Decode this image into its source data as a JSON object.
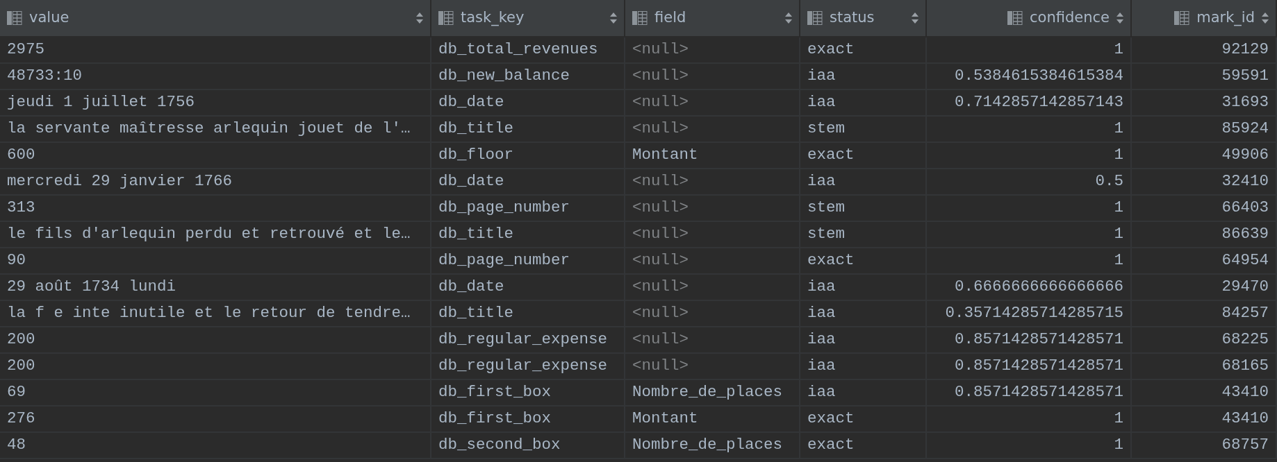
{
  "table": {
    "columns": [
      {
        "label": "value",
        "numeric": false
      },
      {
        "label": "task_key",
        "numeric": false
      },
      {
        "label": "field",
        "numeric": false
      },
      {
        "label": "status",
        "numeric": false
      },
      {
        "label": "confidence",
        "numeric": true
      },
      {
        "label": "mark_id",
        "numeric": true
      }
    ],
    "rows": [
      {
        "cells": [
          {
            "text": "2975",
            "null": false
          },
          {
            "text": "db_total_revenues",
            "null": false
          },
          {
            "text": "<null>",
            "null": true
          },
          {
            "text": "exact",
            "null": false
          },
          {
            "text": "1",
            "null": false
          },
          {
            "text": "92129",
            "null": false
          }
        ]
      },
      {
        "cells": [
          {
            "text": "48733:10",
            "null": false
          },
          {
            "text": "db_new_balance",
            "null": false
          },
          {
            "text": "<null>",
            "null": true
          },
          {
            "text": "iaa",
            "null": false
          },
          {
            "text": "0.5384615384615384",
            "null": false
          },
          {
            "text": "59591",
            "null": false
          }
        ]
      },
      {
        "cells": [
          {
            "text": "jeudi 1 juillet 1756",
            "null": false
          },
          {
            "text": "db_date",
            "null": false
          },
          {
            "text": "<null>",
            "null": true
          },
          {
            "text": "iaa",
            "null": false
          },
          {
            "text": "0.7142857142857143",
            "null": false
          },
          {
            "text": "31693",
            "null": false
          }
        ]
      },
      {
        "cells": [
          {
            "text": "la servante maîtresse arlequin jouet de l'…",
            "null": false
          },
          {
            "text": "db_title",
            "null": false
          },
          {
            "text": "<null>",
            "null": true
          },
          {
            "text": "stem",
            "null": false
          },
          {
            "text": "1",
            "null": false
          },
          {
            "text": "85924",
            "null": false
          }
        ]
      },
      {
        "cells": [
          {
            "text": "600",
            "null": false
          },
          {
            "text": "db_floor",
            "null": false
          },
          {
            "text": "Montant",
            "null": false
          },
          {
            "text": "exact",
            "null": false
          },
          {
            "text": "1",
            "null": false
          },
          {
            "text": "49906",
            "null": false
          }
        ]
      },
      {
        "cells": [
          {
            "text": "mercredi 29 janvier 1766",
            "null": false
          },
          {
            "text": "db_date",
            "null": false
          },
          {
            "text": "<null>",
            "null": true
          },
          {
            "text": "iaa",
            "null": false
          },
          {
            "text": "0.5",
            "null": false
          },
          {
            "text": "32410",
            "null": false
          }
        ]
      },
      {
        "cells": [
          {
            "text": "313",
            "null": false
          },
          {
            "text": "db_page_number",
            "null": false
          },
          {
            "text": "<null>",
            "null": true
          },
          {
            "text": "stem",
            "null": false
          },
          {
            "text": "1",
            "null": false
          },
          {
            "text": "66403",
            "null": false
          }
        ]
      },
      {
        "cells": [
          {
            "text": "le fils d'arlequin perdu et retrouvé et le…",
            "null": false
          },
          {
            "text": "db_title",
            "null": false
          },
          {
            "text": "<null>",
            "null": true
          },
          {
            "text": "stem",
            "null": false
          },
          {
            "text": "1",
            "null": false
          },
          {
            "text": "86639",
            "null": false
          }
        ]
      },
      {
        "cells": [
          {
            "text": "90",
            "null": false
          },
          {
            "text": "db_page_number",
            "null": false
          },
          {
            "text": "<null>",
            "null": true
          },
          {
            "text": "exact",
            "null": false
          },
          {
            "text": "1",
            "null": false
          },
          {
            "text": "64954",
            "null": false
          }
        ]
      },
      {
        "cells": [
          {
            "text": "29 août 1734 lundi",
            "null": false
          },
          {
            "text": "db_date",
            "null": false
          },
          {
            "text": "<null>",
            "null": true
          },
          {
            "text": "iaa",
            "null": false
          },
          {
            "text": "0.6666666666666666",
            "null": false
          },
          {
            "text": "29470",
            "null": false
          }
        ]
      },
      {
        "cells": [
          {
            "text": "la f e inte inutile et le retour de tendre…",
            "null": false
          },
          {
            "text": "db_title",
            "null": false
          },
          {
            "text": "<null>",
            "null": true
          },
          {
            "text": "iaa",
            "null": false
          },
          {
            "text": "0.35714285714285715",
            "null": false
          },
          {
            "text": "84257",
            "null": false
          }
        ]
      },
      {
        "cells": [
          {
            "text": "200",
            "null": false
          },
          {
            "text": "db_regular_expense",
            "null": false
          },
          {
            "text": "<null>",
            "null": true
          },
          {
            "text": "iaa",
            "null": false
          },
          {
            "text": "0.8571428571428571",
            "null": false
          },
          {
            "text": "68225",
            "null": false
          }
        ]
      },
      {
        "cells": [
          {
            "text": "200",
            "null": false
          },
          {
            "text": "db_regular_expense",
            "null": false
          },
          {
            "text": "<null>",
            "null": true
          },
          {
            "text": "iaa",
            "null": false
          },
          {
            "text": "0.8571428571428571",
            "null": false
          },
          {
            "text": "68165",
            "null": false
          }
        ]
      },
      {
        "cells": [
          {
            "text": "69",
            "null": false
          },
          {
            "text": "db_first_box",
            "null": false
          },
          {
            "text": "Nombre_de_places",
            "null": false
          },
          {
            "text": "iaa",
            "null": false
          },
          {
            "text": "0.8571428571428571",
            "null": false
          },
          {
            "text": "43410",
            "null": false
          }
        ]
      },
      {
        "cells": [
          {
            "text": "276",
            "null": false
          },
          {
            "text": "db_first_box",
            "null": false
          },
          {
            "text": "Montant",
            "null": false
          },
          {
            "text": "exact",
            "null": false
          },
          {
            "text": "1",
            "null": false
          },
          {
            "text": "43410",
            "null": false
          }
        ]
      },
      {
        "cells": [
          {
            "text": "48",
            "null": false
          },
          {
            "text": "db_second_box",
            "null": false
          },
          {
            "text": "Nombre_de_places",
            "null": false
          },
          {
            "text": "exact",
            "null": false
          },
          {
            "text": "1",
            "null": false
          },
          {
            "text": "68757",
            "null": false
          }
        ]
      }
    ]
  }
}
